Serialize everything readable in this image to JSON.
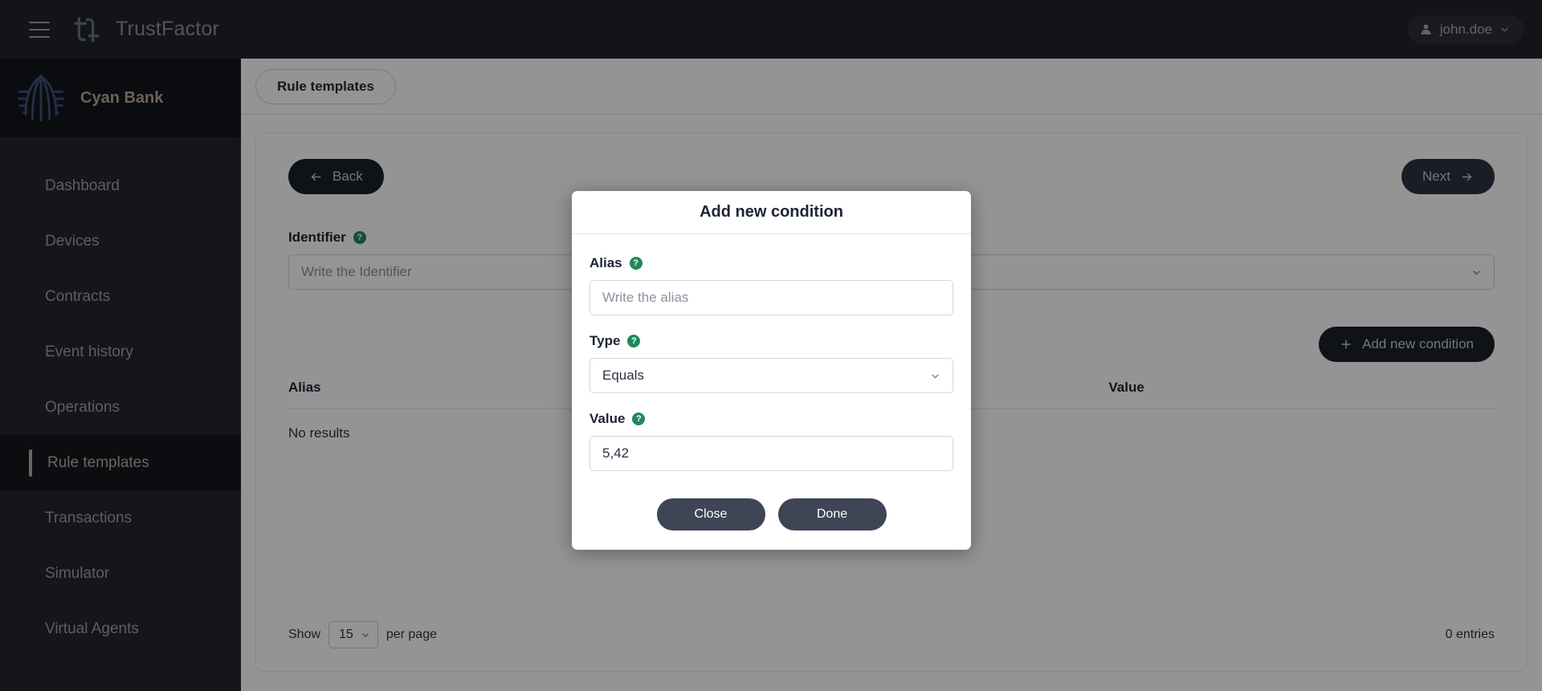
{
  "topbar": {
    "menu_icon": "hamburger-icon",
    "app_logo_icon": "trustfactor-logo-icon",
    "app_name": "TrustFactor",
    "user": {
      "avatar_icon": "user-icon",
      "name": "john.doe",
      "caret_icon": "chevron-down-icon"
    }
  },
  "sidebar": {
    "org": {
      "logo_icon": "cyan-bank-logo-icon",
      "name": "Cyan Bank"
    },
    "items": [
      {
        "label": "Dashboard",
        "active": false
      },
      {
        "label": "Devices",
        "active": false
      },
      {
        "label": "Contracts",
        "active": false
      },
      {
        "label": "Event history",
        "active": false
      },
      {
        "label": "Operations",
        "active": false
      },
      {
        "label": "Rule templates",
        "active": true
      },
      {
        "label": "Transactions",
        "active": false
      },
      {
        "label": "Simulator",
        "active": false
      },
      {
        "label": "Virtual Agents",
        "active": false
      }
    ]
  },
  "breadcrumb": {
    "label": "Rule templates"
  },
  "wizard": {
    "back_label": "Back",
    "back_icon": "arrow-left-icon",
    "next_label": "Next",
    "next_icon": "arrow-right-icon"
  },
  "form": {
    "identifier": {
      "label": "Identifier",
      "help_icon": "help-circle-icon",
      "placeholder": "Write the Identifier",
      "value": "",
      "caret_icon": "chevron-down-icon"
    },
    "add_condition": {
      "label": "Add new condition",
      "icon": "plus-icon"
    }
  },
  "table": {
    "columns": [
      "Alias",
      "Value"
    ],
    "empty_text": "No results",
    "rows": []
  },
  "pagination": {
    "show_label": "Show",
    "per_page_value": "15",
    "per_page_label": "per page",
    "caret_icon": "chevron-down-icon",
    "entries_text": "0 entries"
  },
  "modal": {
    "title": "Add new condition",
    "alias": {
      "label": "Alias",
      "help_icon": "help-circle-icon",
      "placeholder": "Write the alias",
      "value": ""
    },
    "type": {
      "label": "Type",
      "help_icon": "help-circle-icon",
      "value": "Equals",
      "caret_icon": "chevron-down-icon"
    },
    "value": {
      "label": "Value",
      "help_icon": "help-circle-icon",
      "value": "5,42",
      "placeholder": ""
    },
    "close_label": "Close",
    "done_label": "Done"
  },
  "colors": {
    "topbar_bg": "#20242e",
    "sidebar_bg": "#23262f",
    "accent_help": "#1f8a5b",
    "button_dark": "#1b1f28",
    "modal_button": "#3e4554"
  }
}
